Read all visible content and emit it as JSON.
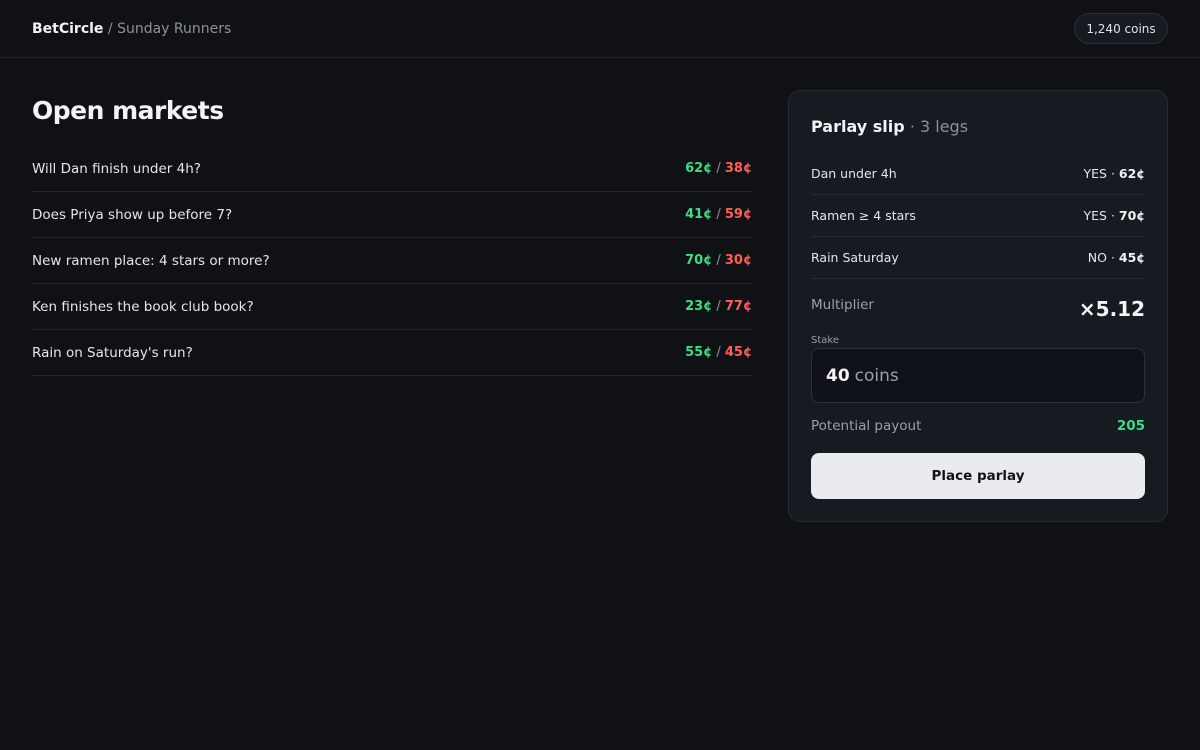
{
  "header": {
    "brand": "BetCircle",
    "separator": "/",
    "group": "Sunday Runners",
    "coins": "1,240 coins"
  },
  "markets": {
    "title": "Open markets",
    "items": [
      {
        "question": "Will Dan finish under 4h?",
        "yes": "62¢",
        "no": "38¢"
      },
      {
        "question": "Does Priya show up before 7?",
        "yes": "41¢",
        "no": "59¢"
      },
      {
        "question": "New ramen place: 4 stars or more?",
        "yes": "70¢",
        "no": "30¢"
      },
      {
        "question": "Ken finishes the book club book?",
        "yes": "23¢",
        "no": "77¢"
      },
      {
        "question": "Rain on Saturday's run?",
        "yes": "55¢",
        "no": "45¢"
      }
    ]
  },
  "slip": {
    "title": "Parlay slip",
    "dot": "·",
    "legs_count": "3 legs",
    "legs": [
      {
        "name": "Dan under 4h",
        "side": "YES",
        "price": "62¢"
      },
      {
        "name": "Ramen ≥ 4 stars",
        "side": "YES",
        "price": "70¢"
      },
      {
        "name": "Rain Saturday",
        "side": "NO",
        "price": "45¢"
      }
    ],
    "multiplier_label": "Multiplier",
    "multiplier_value": "×5.12",
    "stake_label": "Stake",
    "stake_amount": "40",
    "stake_unit": "coins",
    "payout_label": "Potential payout",
    "payout_value": "205",
    "place_button": "Place parlay"
  },
  "colors": {
    "background": "#0f1115",
    "panel": "#161a21",
    "yes": "#3ddc84",
    "no": "#ff5f56",
    "button": "#e9ebef"
  }
}
